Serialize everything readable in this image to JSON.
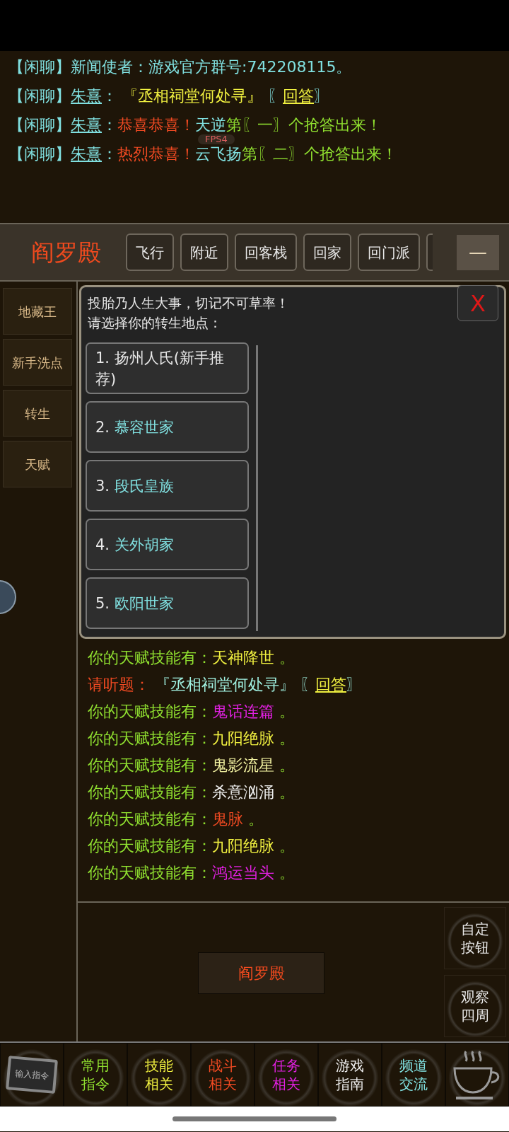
{
  "chat_top": [
    {
      "color": "#80e0e0",
      "segments": [
        {
          "kind": "text",
          "text": "【闲聊】新闻使者：游戏官方群号:742208115。"
        }
      ]
    },
    {
      "color": "#80e0e0",
      "segments": [
        {
          "kind": "text",
          "text": "【闲聊】"
        },
        {
          "kind": "link",
          "text": "朱熹"
        },
        {
          "kind": "text",
          "text": "："
        },
        {
          "kind": "text",
          "text": " 『丞相祠堂何处寻』",
          "color": "#f0f040"
        },
        {
          "kind": "text",
          "text": " 〖"
        },
        {
          "kind": "link",
          "text": "回答",
          "color": "#f0f040"
        },
        {
          "kind": "text",
          "text": "〗"
        }
      ]
    },
    {
      "color": "#80e0e0",
      "segments": [
        {
          "kind": "text",
          "text": "【闲聊】"
        },
        {
          "kind": "link",
          "text": "朱熹"
        },
        {
          "kind": "text",
          "text": "："
        },
        {
          "kind": "text",
          "text": "恭喜恭喜！",
          "color": "#f04a22"
        },
        {
          "kind": "text",
          "text": "天逆"
        },
        {
          "kind": "text",
          "text": "第〖一〗个抢答出来！",
          "color": "#90e030"
        }
      ]
    },
    {
      "color": "#80e0e0",
      "segments": [
        {
          "kind": "text",
          "text": "【闲聊】"
        },
        {
          "kind": "link",
          "text": "朱熹"
        },
        {
          "kind": "text",
          "text": "："
        },
        {
          "kind": "text",
          "text": "热烈恭喜！",
          "color": "#f04a22"
        },
        {
          "kind": "text",
          "text": "云飞扬"
        },
        {
          "kind": "text",
          "text": "第〖二〗个抢答出来！",
          "color": "#90e030"
        }
      ]
    }
  ],
  "fps_overlay": "FPS4",
  "header": {
    "location": "阎罗殿",
    "buttons": [
      "飞行",
      "附近",
      "回客栈",
      "回家",
      "回门派"
    ],
    "minimize": "—"
  },
  "sidebar": {
    "items": [
      "地藏王",
      "新手洗点",
      "转生",
      "天赋"
    ]
  },
  "dialog": {
    "lines": [
      "投胎乃人生大事，切记不可草率！",
      "请选择你的转生地点："
    ],
    "close": "X",
    "options": [
      {
        "number": "1.",
        "label": "扬州人氏(新手推荐)",
        "color": "#e8e8e8"
      },
      {
        "number": "2.",
        "label": "慕容世家",
        "color": "#80e0e0"
      },
      {
        "number": "3.",
        "label": "段氏皇族",
        "color": "#80e0e0"
      },
      {
        "number": "4.",
        "label": "关外胡家",
        "color": "#80e0e0"
      },
      {
        "number": "5.",
        "label": "欧阳世家",
        "color": "#80e0e0"
      }
    ]
  },
  "chat_log": [
    {
      "color": "#90e030",
      "segments": [
        {
          "kind": "text",
          "text": "你的天赋技能有："
        },
        {
          "kind": "text",
          "text": "天神降世",
          "color": "#f0f040"
        },
        {
          "kind": "text",
          "text": " 。"
        }
      ]
    },
    {
      "color": "#a0f0e0",
      "segments": [
        {
          "kind": "text",
          "text": "请听题：",
          "color": "#f04a22"
        },
        {
          "kind": "text",
          "text": " 『丞相祠堂何处寻』"
        },
        {
          "kind": "text",
          "text": " 〖"
        },
        {
          "kind": "link",
          "text": "回答",
          "color": "#f0f040"
        },
        {
          "kind": "text",
          "text": "〗"
        }
      ]
    },
    {
      "color": "#90e030",
      "segments": [
        {
          "kind": "text",
          "text": "你的天赋技能有："
        },
        {
          "kind": "text",
          "text": "鬼话连篇",
          "color": "#e020e0"
        },
        {
          "kind": "text",
          "text": " 。"
        }
      ]
    },
    {
      "color": "#90e030",
      "segments": [
        {
          "kind": "text",
          "text": "你的天赋技能有："
        },
        {
          "kind": "text",
          "text": "九阳绝脉",
          "color": "#f0f040"
        },
        {
          "kind": "text",
          "text": " 。"
        }
      ]
    },
    {
      "color": "#90e030",
      "segments": [
        {
          "kind": "text",
          "text": "你的天赋技能有："
        },
        {
          "kind": "text",
          "text": "鬼影流星",
          "color": "#f0f0a0"
        },
        {
          "kind": "text",
          "text": " 。"
        }
      ]
    },
    {
      "color": "#90e030",
      "segments": [
        {
          "kind": "text",
          "text": "你的天赋技能有："
        },
        {
          "kind": "text",
          "text": "杀意汹涌",
          "color": "#f0f0f0"
        },
        {
          "kind": "text",
          "text": " 。"
        }
      ]
    },
    {
      "color": "#90e030",
      "segments": [
        {
          "kind": "text",
          "text": "你的天赋技能有："
        },
        {
          "kind": "text",
          "text": "鬼脉",
          "color": "#f04a22"
        },
        {
          "kind": "text",
          "text": " 。"
        }
      ]
    },
    {
      "color": "#90e030",
      "segments": [
        {
          "kind": "text",
          "text": "你的天赋技能有："
        },
        {
          "kind": "text",
          "text": "九阳绝脉",
          "color": "#f0f040"
        },
        {
          "kind": "text",
          "text": " 。"
        }
      ]
    },
    {
      "color": "#90e030",
      "segments": [
        {
          "kind": "text",
          "text": "你的天赋技能有："
        },
        {
          "kind": "text",
          "text": "鸿运当头",
          "color": "#e020e0"
        },
        {
          "kind": "text",
          "text": " 。"
        }
      ]
    }
  ],
  "location_button": "阎罗殿",
  "side_buttons": [
    "自定按钮",
    "观察四周"
  ],
  "bottom_bar": [
    {
      "kind": "input",
      "label": "输入指令"
    },
    {
      "kind": "text",
      "label": "常用指令",
      "color": "#90e030"
    },
    {
      "kind": "text",
      "label": "技能相关",
      "color": "#f0f040"
    },
    {
      "kind": "text",
      "label": "战斗相关",
      "color": "#f04a22"
    },
    {
      "kind": "text",
      "label": "任务相关",
      "color": "#e020e0"
    },
    {
      "kind": "text",
      "label": "游戏指南",
      "color": "#f0f0f0"
    },
    {
      "kind": "text",
      "label": "频道交流",
      "color": "#80e0e0"
    },
    {
      "kind": "cup"
    }
  ]
}
